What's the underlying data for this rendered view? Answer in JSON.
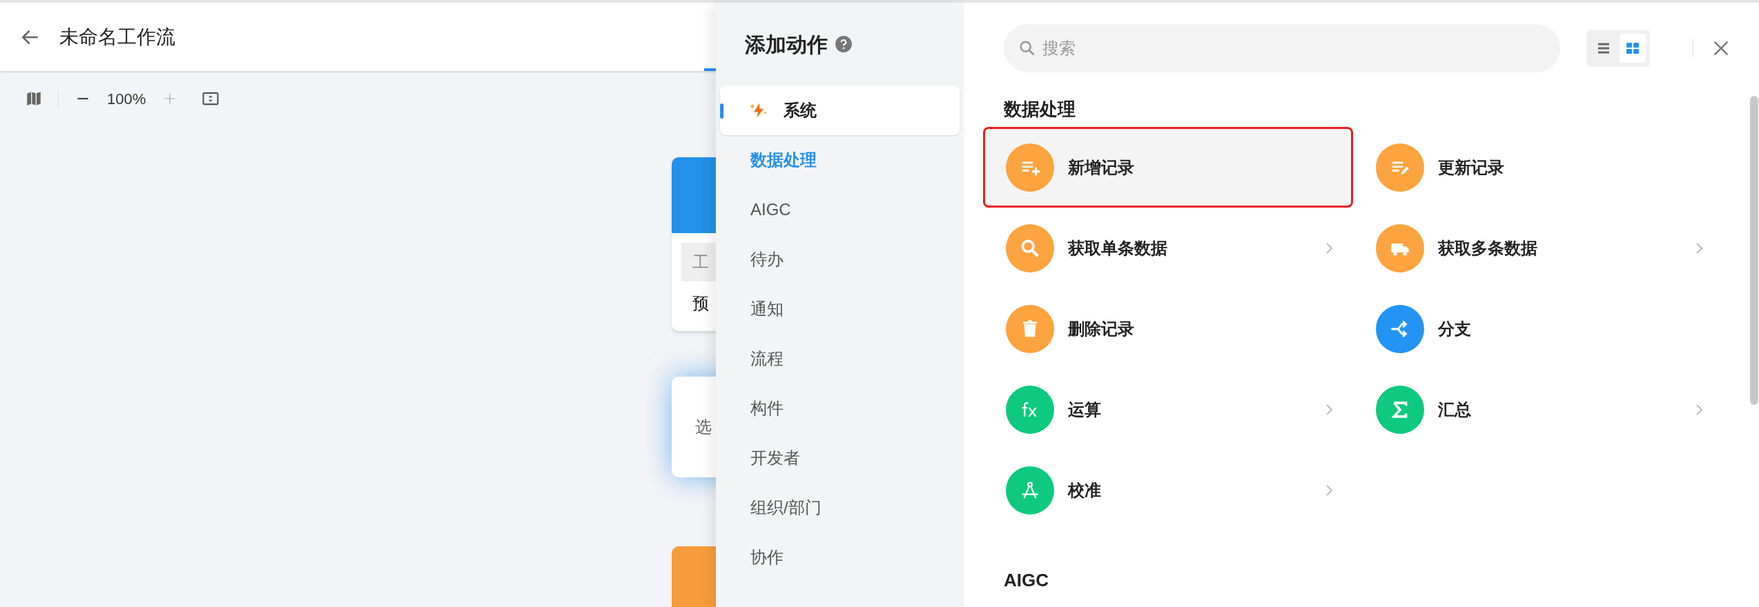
{
  "header": {
    "title": "未命名工作流"
  },
  "toolbar": {
    "zoom": "100%"
  },
  "canvas": {
    "cards": [
      {
        "kind": "trigger",
        "color": "#2490ea",
        "field": "工",
        "text": "预"
      },
      {
        "kind": "empty",
        "text": "选"
      },
      {
        "kind": "action",
        "color": "#f79c3c"
      }
    ]
  },
  "panel": {
    "title": "添加动作",
    "group": {
      "label": "系统",
      "selected": true
    },
    "categories": [
      {
        "label": "数据处理",
        "selected": true
      },
      {
        "label": "AIGC",
        "selected": false
      },
      {
        "label": "待办",
        "selected": false
      },
      {
        "label": "通知",
        "selected": false
      },
      {
        "label": "流程",
        "selected": false
      },
      {
        "label": "构件",
        "selected": false
      },
      {
        "label": "开发者",
        "selected": false
      },
      {
        "label": "组织/部门",
        "selected": false
      },
      {
        "label": "协作",
        "selected": false
      }
    ],
    "search": {
      "placeholder": "搜索"
    },
    "view_toggle": [
      {
        "kind": "list",
        "selected": false
      },
      {
        "kind": "grid",
        "selected": true
      }
    ],
    "sections": [
      {
        "title": "数据处理",
        "items": [
          {
            "label": "新增记录",
            "color": "#fda33f",
            "submenu": false,
            "selected": true
          },
          {
            "label": "更新记录",
            "color": "#fda33f",
            "submenu": false,
            "selected": false
          },
          {
            "label": "获取单条数据",
            "color": "#fda33f",
            "submenu": true,
            "selected": false
          },
          {
            "label": "获取多条数据",
            "color": "#fda33f",
            "submenu": true,
            "selected": false
          },
          {
            "label": "删除记录",
            "color": "#fda33f",
            "submenu": false,
            "selected": false
          },
          {
            "label": "分支",
            "color": "#2394f3",
            "submenu": false,
            "selected": false
          },
          {
            "label": "运算",
            "color": "#0ec97f",
            "submenu": true,
            "selected": false
          },
          {
            "label": "汇总",
            "color": "#0ec97f",
            "submenu": true,
            "selected": false
          },
          {
            "label": "校准",
            "color": "#0ec97f",
            "submenu": true,
            "selected": false
          }
        ]
      },
      {
        "title": "AIGC"
      }
    ]
  }
}
